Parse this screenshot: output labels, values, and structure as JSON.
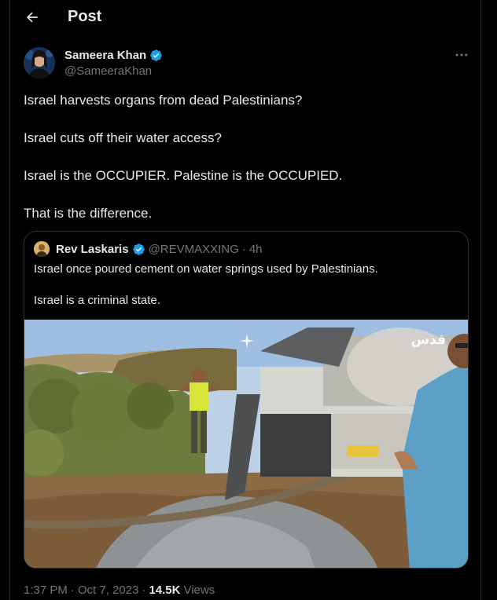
{
  "header": {
    "title": "Post"
  },
  "author": {
    "name": "Sameera Khan",
    "handle": "@SameeraKhan"
  },
  "tweet": {
    "lines": [
      "Israel harvests organs from dead Palestinians?",
      "Israel cuts off their water access?",
      "Israel is the OCCUPIER. Palestine is the OCCUPIED.",
      "That is the difference."
    ]
  },
  "quote": {
    "name": "Rev Laskaris",
    "handle": "@REVMAXXING",
    "separator": "·",
    "age": "4h",
    "line1": "Israel once poured cement on water springs used by Palestinians.",
    "line2": "Israel is a criminal state.",
    "watermark": "قدس"
  },
  "meta": {
    "time": "1:37 PM",
    "sep1": "·",
    "date": "Oct 7, 2023",
    "sep2": "·",
    "views_count": "14.5K",
    "views_label": "Views"
  },
  "colors": {
    "background": "#000000",
    "text_primary": "#e7e9ea",
    "text_secondary": "#71767b",
    "border": "#2f3336",
    "verified_blue": "#1d9bf0"
  },
  "icons": {
    "back": "arrow-left-icon",
    "verified": "verified-badge-icon",
    "more": "more-horizontal-icon",
    "sparkle": "sparkle-icon"
  }
}
